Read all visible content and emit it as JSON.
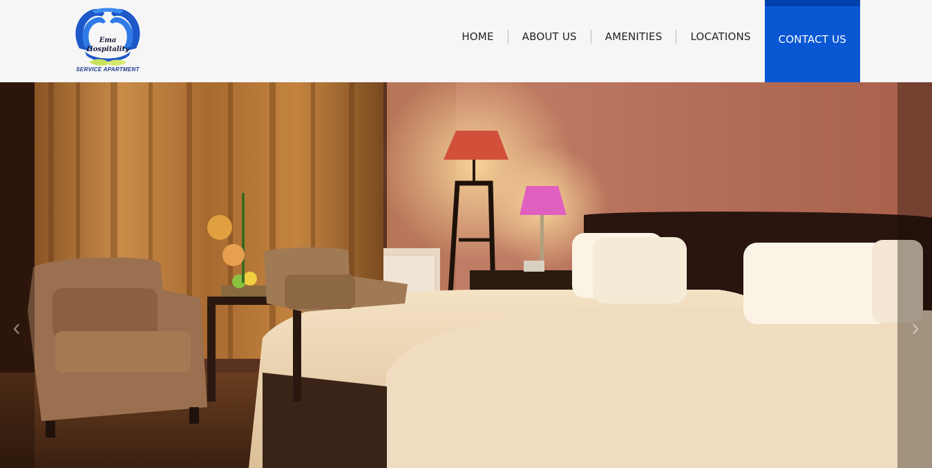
{
  "brand": {
    "line1": "Ema",
    "line2": "Hospitality",
    "tagline": "SERVICE APARTMENT"
  },
  "nav": {
    "items": [
      {
        "label": "HOME"
      },
      {
        "label": "ABOUT US"
      },
      {
        "label": "AMENITIES"
      },
      {
        "label": "LOCATIONS"
      },
      {
        "label": "CONTACT US",
        "active": true
      }
    ]
  },
  "hero": {
    "image": "hotel-room-photo",
    "prev_icon": "chevron-left-icon",
    "next_icon": "chevron-right-icon",
    "prev_glyph": "‹",
    "next_glyph": "›"
  },
  "colors": {
    "accent": "#0a57d4",
    "header_bg": "#f6f6f6",
    "nav_text": "#222222"
  }
}
